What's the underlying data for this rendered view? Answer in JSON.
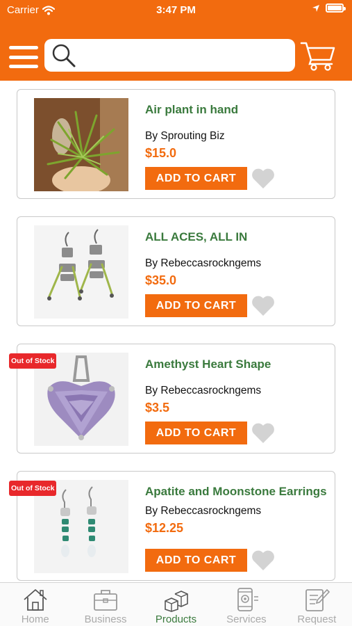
{
  "status_bar": {
    "carrier": "Carrier",
    "time": "3:47 PM"
  },
  "header": {
    "search": {
      "placeholder": "",
      "value": ""
    },
    "icons": [
      "menu-icon",
      "search-icon",
      "cart-icon"
    ],
    "background": "#f26b0f"
  },
  "products": [
    {
      "name": "Air plant in hand",
      "seller": "By Sprouting Biz",
      "price": "$15.0",
      "button": "ADD TO CART",
      "out_of_stock": false,
      "badge": ""
    },
    {
      "name": "ALL ACES, ALL IN",
      "seller": "By Rebeccasrockngems",
      "price": "$35.0",
      "button": "ADD TO CART",
      "out_of_stock": false,
      "badge": ""
    },
    {
      "name": "Amethyst Heart Shape",
      "seller": "By Rebeccasrockngems",
      "price": "$3.5",
      "button": "ADD TO CART",
      "out_of_stock": true,
      "badge": "Out of Stock"
    },
    {
      "name": "Apatite and Moonstone Earrings",
      "seller": "By Rebeccasrockngems",
      "price": "$12.25",
      "button": "ADD TO CART",
      "out_of_stock": true,
      "badge": "Out of Stock"
    }
  ],
  "tabs": [
    {
      "label": "Home",
      "icon": "home-icon",
      "active": false
    },
    {
      "label": "Business",
      "icon": "briefcase-icon",
      "active": false
    },
    {
      "label": "Products",
      "icon": "boxes-icon",
      "active": true
    },
    {
      "label": "Services",
      "icon": "phone-gear-icon",
      "active": false
    },
    {
      "label": "Request",
      "icon": "clipboard-pen-icon",
      "active": false
    }
  ],
  "colors": {
    "accent": "#f26b0f",
    "product_title": "#3a7a3d",
    "badge": "#e8282b",
    "heart": "#d3d3d3"
  }
}
